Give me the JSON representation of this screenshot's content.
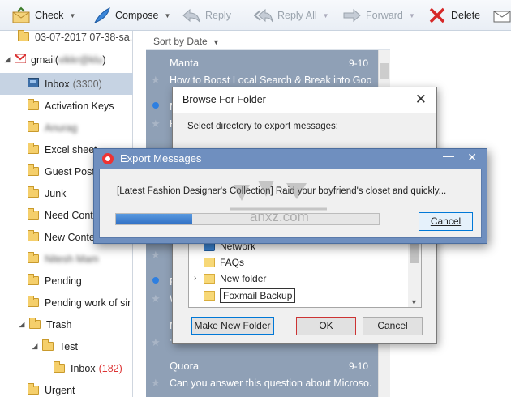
{
  "toolbar": {
    "check": "Check",
    "compose": "Compose",
    "reply": "Reply",
    "reply_all": "Reply All",
    "forward": "Forward",
    "delete": "Delete"
  },
  "sidebar": {
    "top_item": "03-07-2017 07-38-sa...",
    "account": "gmail(",
    "account_blur": "vikkr@klu",
    "account_suffix": ")",
    "inbox": "Inbox",
    "inbox_count": "(3300)",
    "items": [
      {
        "label": "Activation Keys"
      },
      {
        "label": "Anurag"
      },
      {
        "label": "Excel sheet"
      },
      {
        "label": "Guest Post"
      },
      {
        "label": "Junk"
      },
      {
        "label": "Need Conte"
      },
      {
        "label": "New Conte"
      },
      {
        "label": "Nitesh Mam"
      },
      {
        "label": "Pending"
      },
      {
        "label": "Pending work of sir"
      },
      {
        "label": "Trash"
      },
      {
        "label": "Test"
      },
      {
        "label": "Inbox",
        "count": "(182)"
      },
      {
        "label": "Urgent"
      }
    ]
  },
  "list": {
    "sort_label": "Sort by Date",
    "messages": [
      {
        "from": "Manta",
        "date": "9-10",
        "subject": "How to Boost Local Search & Break into Goo..."
      },
      {
        "from": "M",
        "date": "",
        "subject": "H"
      },
      {
        "from": "Z",
        "date": "",
        "subject": ""
      },
      {
        "from": "Y",
        "date": "",
        "subject": ""
      },
      {
        "from": "F",
        "date": "",
        "subject": "W"
      },
      {
        "from": "M",
        "date": "",
        "subject": "\""
      },
      {
        "from": "Quora",
        "date": "9-10",
        "subject": "Can you answer this question about Microso..."
      }
    ]
  },
  "browse_dialog": {
    "title": "Browse For Folder",
    "description": "Select directory to export messages:",
    "tree": [
      "Network",
      "FAQs",
      "New folder",
      "Foxmail Backup"
    ],
    "make_new_folder": "Make New Folder",
    "ok": "OK",
    "cancel": "Cancel"
  },
  "export_dialog": {
    "title": "Export Messages",
    "message": "[Latest Fashion Designer's Collection] Raid your boyfriend's closet and quickly...",
    "progress": 0.29,
    "cancel": "Cancel"
  },
  "watermark": {
    "text": "anxz.com"
  },
  "colors": {
    "accent": "#0078d7",
    "list_bg": "#8fa0b6",
    "export_title_bg": "#6f8fbf",
    "unread_dot": "#2e7fe0"
  }
}
